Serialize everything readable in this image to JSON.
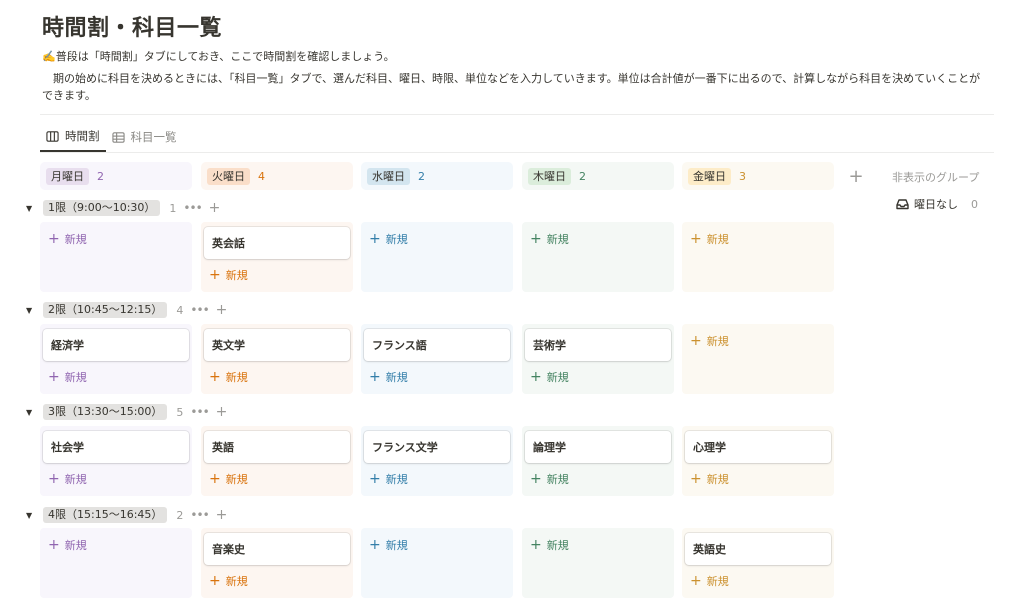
{
  "page": {
    "title": "時間割・科目一覧",
    "description_line1": "✍️普段は「時間割」タブにしておき、ここで時間割を確認しましょう。",
    "description_line2": "　期の始めに科目を決めるときには、「科目一覧」タブで、選んだ科目、曜日、時限、単位などを入力していきます。単位は合計値が一番下に出るので、計算しながら科目を決めていくことができます。"
  },
  "views": [
    {
      "label": "時間割",
      "icon": "board-icon",
      "active": true
    },
    {
      "label": "科目一覧",
      "icon": "table-icon",
      "active": false
    }
  ],
  "columns": [
    {
      "label": "月曜日",
      "count": "2",
      "bg": "#f8f6fc",
      "tag_bg": "#e8deee",
      "accent": "#9065b0"
    },
    {
      "label": "火曜日",
      "count": "4",
      "bg": "#fdf6f1",
      "tag_bg": "#fadec9",
      "accent": "#d9730d"
    },
    {
      "label": "水曜日",
      "count": "2",
      "bg": "#f3f8fc",
      "tag_bg": "#d3e5ef",
      "accent": "#337ea9"
    },
    {
      "label": "木曜日",
      "count": "2",
      "bg": "#f4f8f5",
      "tag_bg": "#dbeddb",
      "accent": "#448361"
    },
    {
      "label": "金曜日",
      "count": "3",
      "bg": "#fcf9f2",
      "tag_bg": "#fdecc8",
      "accent": "#cb912f"
    }
  ],
  "add_column_label": "+",
  "hidden_groups_label": "非表示のグループ",
  "no_day": {
    "label": "曜日なし",
    "count": "0"
  },
  "new_label": "新規",
  "groups": [
    {
      "label": "1限（9:00〜10:30）",
      "count": "1",
      "cells": [
        "",
        "英会話",
        "",
        "",
        ""
      ]
    },
    {
      "label": "2限（10:45〜12:15）",
      "count": "4",
      "cells": [
        "経済学",
        "英文学",
        "フランス語",
        "芸術学",
        ""
      ]
    },
    {
      "label": "3限（13:30〜15:00）",
      "count": "5",
      "cells": [
        "社会学",
        "英語",
        "フランス文学",
        "論理学",
        "心理学"
      ]
    },
    {
      "label": "4限（15:15〜16:45）",
      "count": "2",
      "cells": [
        "",
        "音楽史",
        "",
        "",
        "英語史"
      ]
    }
  ]
}
